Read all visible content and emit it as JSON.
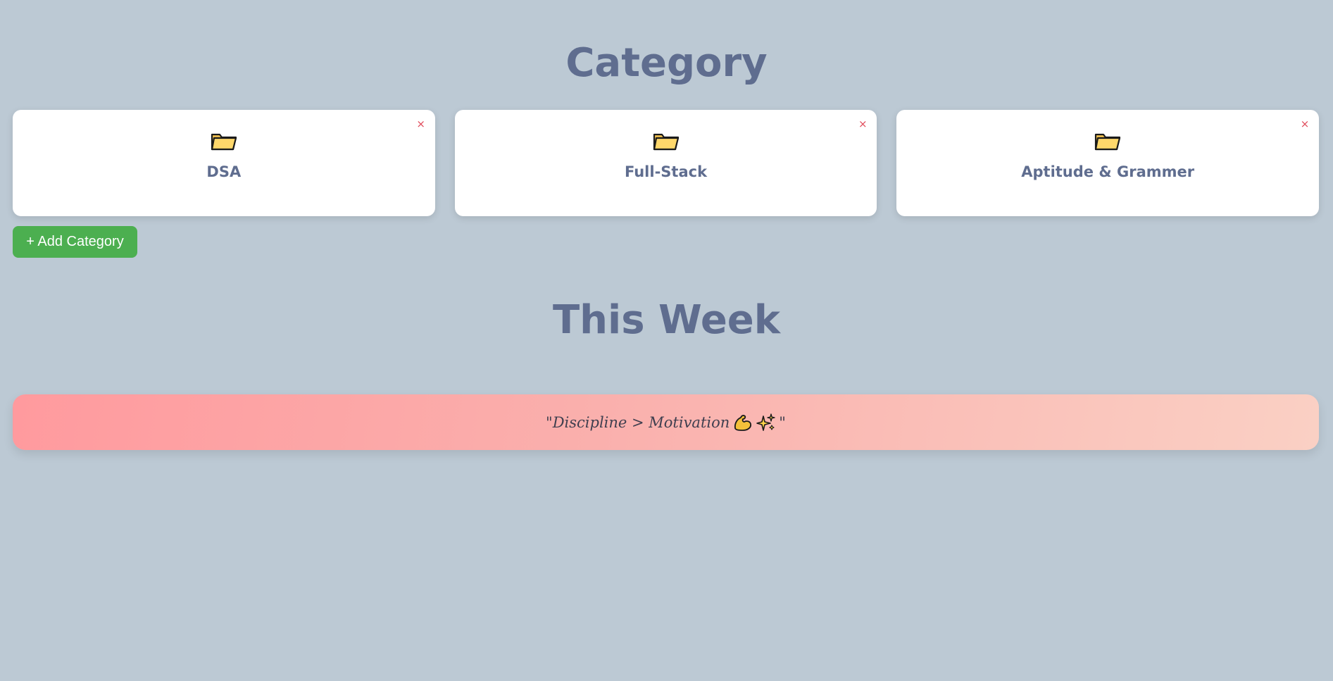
{
  "category_section": {
    "title": "Category",
    "cards": [
      {
        "label": "DSA",
        "icon": "folder-icon",
        "close": "×"
      },
      {
        "label": "Full-Stack",
        "icon": "folder-icon",
        "close": "×"
      },
      {
        "label": "Aptitude & Grammer",
        "icon": "folder-icon",
        "close": "×"
      }
    ],
    "add_button_label": "+ Add Category"
  },
  "week_section": {
    "title": "This Week"
  },
  "quote": {
    "open_text": "\"Discipline > Motivation",
    "close_text": "\"",
    "icons": [
      "flexed-biceps-icon",
      "sparkles-icon"
    ]
  },
  "colors": {
    "background": "#bcc9d4",
    "heading": "#5f6d8f",
    "card_bg": "#ffffff",
    "close": "#e04b5a",
    "add_button": "#4caf50",
    "quote_gradient_start": "#ff9a9e",
    "quote_gradient_end": "#fad0c4"
  }
}
